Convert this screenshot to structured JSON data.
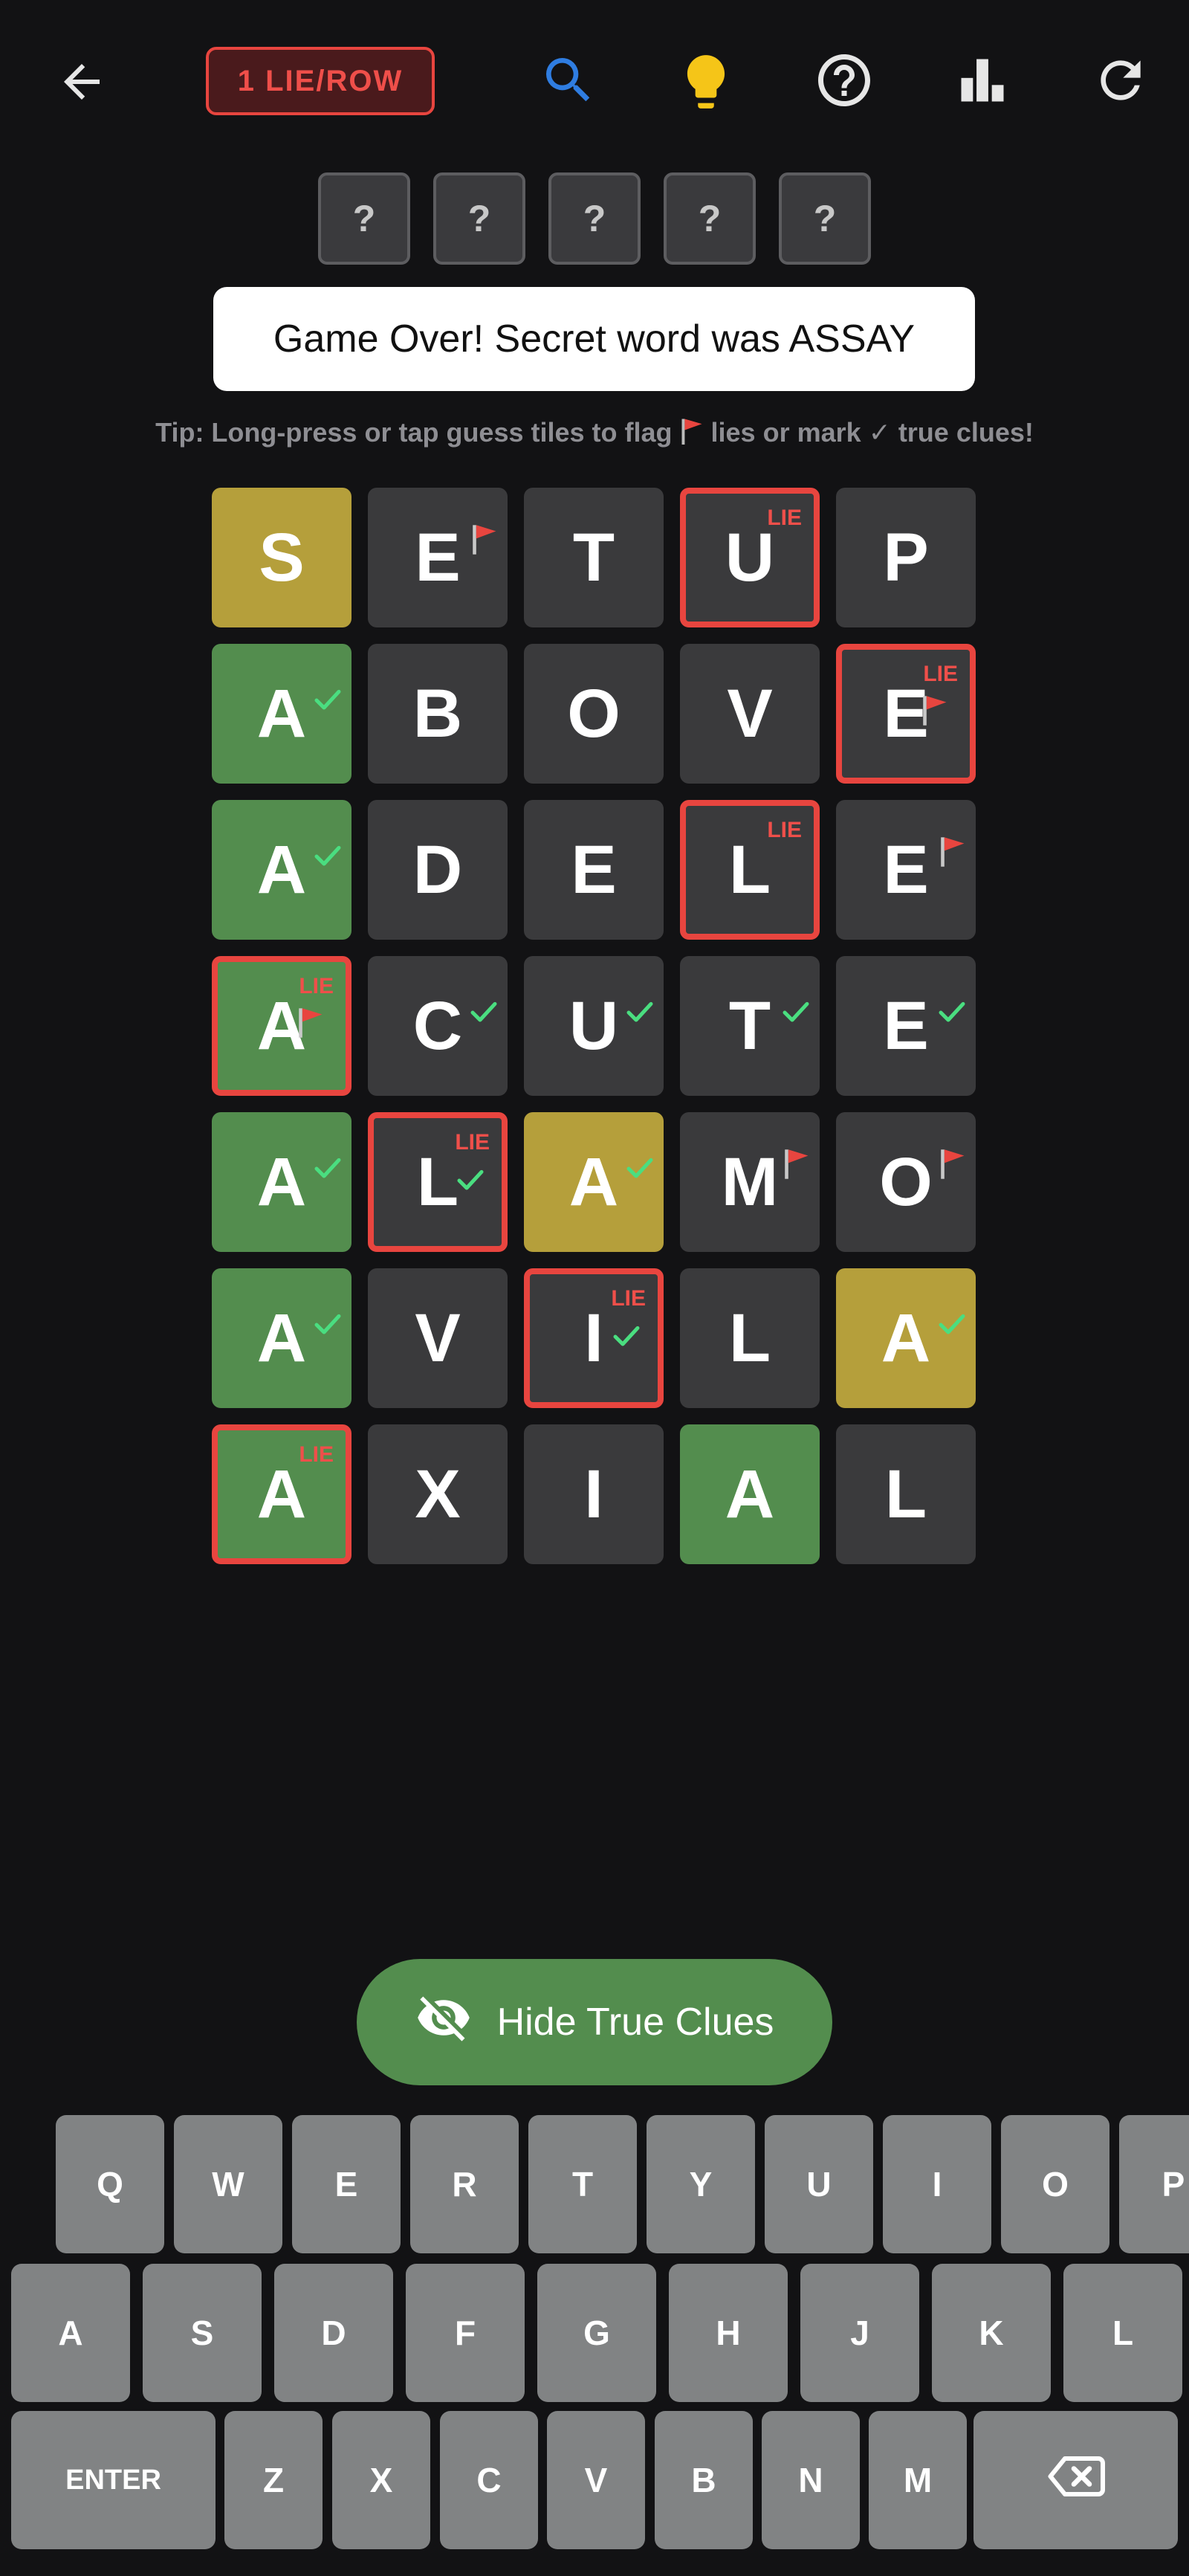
{
  "header": {
    "mode_badge": "1 LIE/ROW",
    "icons": [
      "back-arrow-icon",
      "search-icon",
      "lightbulb-icon",
      "help-circle-icon",
      "stats-bars-icon",
      "refresh-icon"
    ],
    "colors": {
      "search": "#2f7de1",
      "lightbulb": "#f5c518",
      "badge": "#e8453f"
    }
  },
  "secret": [
    "?",
    "?",
    "?",
    "?",
    "?"
  ],
  "message": "Game Over! Secret word was ASSAY",
  "tip": {
    "before": "Tip: Long-press or tap guess tiles to flag",
    "middle": "lies or mark ✓ true clues!"
  },
  "board": [
    [
      {
        "l": "S",
        "c": "yellow",
        "m": ""
      },
      {
        "l": "E",
        "c": "gray",
        "m": "flag"
      },
      {
        "l": "T",
        "c": "gray",
        "m": ""
      },
      {
        "l": "U",
        "c": "gray",
        "m": "lie"
      },
      {
        "l": "P",
        "c": "gray",
        "m": ""
      }
    ],
    [
      {
        "l": "A",
        "c": "green",
        "m": "check"
      },
      {
        "l": "B",
        "c": "gray",
        "m": ""
      },
      {
        "l": "O",
        "c": "gray",
        "m": ""
      },
      {
        "l": "V",
        "c": "gray",
        "m": ""
      },
      {
        "l": "E",
        "c": "gray",
        "m": "lieflag"
      }
    ],
    [
      {
        "l": "A",
        "c": "green",
        "m": "check"
      },
      {
        "l": "D",
        "c": "gray",
        "m": ""
      },
      {
        "l": "E",
        "c": "gray",
        "m": ""
      },
      {
        "l": "L",
        "c": "gray",
        "m": "lie"
      },
      {
        "l": "E",
        "c": "gray",
        "m": "flag"
      }
    ],
    [
      {
        "l": "A",
        "c": "green",
        "m": "lieflag"
      },
      {
        "l": "C",
        "c": "gray",
        "m": "check"
      },
      {
        "l": "U",
        "c": "gray",
        "m": "check"
      },
      {
        "l": "T",
        "c": "gray",
        "m": "check"
      },
      {
        "l": "E",
        "c": "gray",
        "m": "check"
      }
    ],
    [
      {
        "l": "A",
        "c": "green",
        "m": "check"
      },
      {
        "l": "L",
        "c": "gray",
        "m": "liecheck"
      },
      {
        "l": "A",
        "c": "yellow",
        "m": "check"
      },
      {
        "l": "M",
        "c": "gray",
        "m": "flag"
      },
      {
        "l": "O",
        "c": "gray",
        "m": "flag"
      }
    ],
    [
      {
        "l": "A",
        "c": "green",
        "m": "check"
      },
      {
        "l": "V",
        "c": "gray",
        "m": ""
      },
      {
        "l": "I",
        "c": "gray",
        "m": "liecheck"
      },
      {
        "l": "L",
        "c": "gray",
        "m": ""
      },
      {
        "l": "A",
        "c": "yellow",
        "m": "check"
      }
    ],
    [
      {
        "l": "A",
        "c": "green",
        "m": "lie"
      },
      {
        "l": "X",
        "c": "gray",
        "m": ""
      },
      {
        "l": "I",
        "c": "gray",
        "m": ""
      },
      {
        "l": "A",
        "c": "green",
        "m": ""
      },
      {
        "l": "L",
        "c": "gray",
        "m": ""
      }
    ]
  ],
  "lie_text": "LIE",
  "hide_button": {
    "label": "Hide True Clues",
    "icon": "eye-off-icon"
  },
  "keyboard": {
    "row1": [
      "Q",
      "W",
      "E",
      "R",
      "T",
      "Y",
      "U",
      "I",
      "O",
      "P"
    ],
    "row2": [
      "A",
      "S",
      "D",
      "F",
      "G",
      "H",
      "J",
      "K",
      "L"
    ],
    "row3": [
      "ENTER",
      "Z",
      "X",
      "C",
      "V",
      "B",
      "N",
      "M",
      "backspace-icon"
    ]
  }
}
